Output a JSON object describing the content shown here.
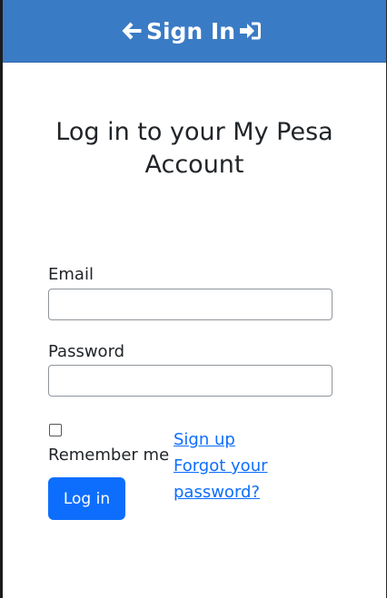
{
  "header": {
    "title": "Sign In",
    "left_icon": "arrow-left-icon",
    "right_icon": "sign-in-icon",
    "background": "#3a7bc5"
  },
  "page": {
    "heading_line1": "Log in to your My Pesa",
    "heading_line2": "Account"
  },
  "form": {
    "email_label": "Email",
    "email_value": "",
    "password_label": "Password",
    "password_value": "",
    "remember_label": "Remember me",
    "remember_checked": false,
    "login_button": "Log in",
    "login_button_color": "#0d6efd"
  },
  "links": {
    "signup": "Sign up",
    "forgot": "Forgot your password?"
  }
}
